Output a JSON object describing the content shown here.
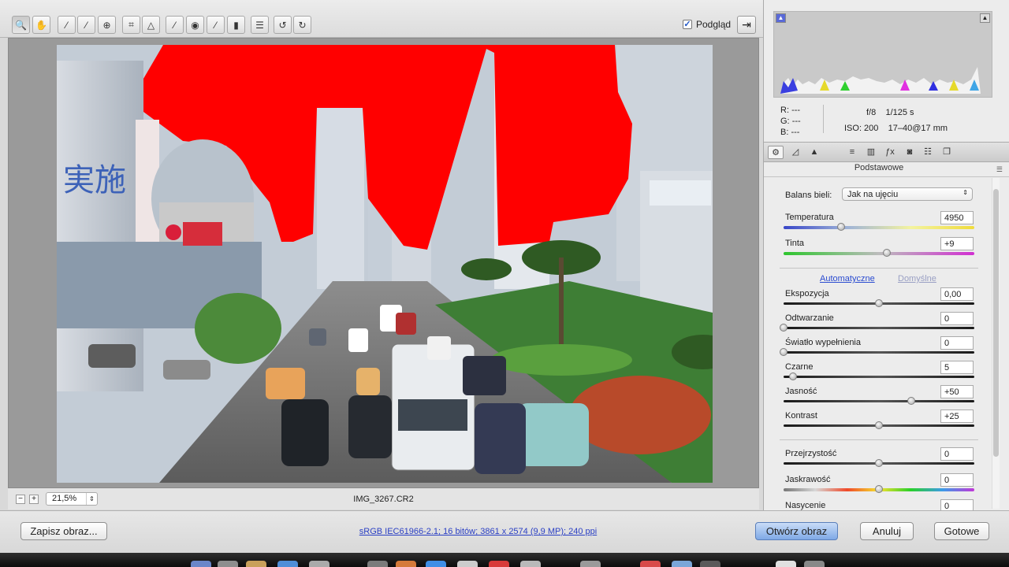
{
  "toolbar": {
    "tools": [
      {
        "name": "zoom-tool",
        "icon": "magnifier-icon",
        "glyph": "🔍"
      },
      {
        "name": "hand-tool",
        "icon": "hand-icon",
        "glyph": "✋"
      },
      {
        "name": "white-balance-tool",
        "icon": "eyedropper-icon",
        "glyph": "⁄"
      },
      {
        "name": "color-sampler-tool",
        "icon": "color-sampler-icon",
        "glyph": "⁄"
      },
      {
        "name": "targeted-adjustment-tool",
        "icon": "target-icon",
        "glyph": "⊕"
      },
      {
        "name": "crop-tool",
        "icon": "crop-icon",
        "glyph": "⌗"
      },
      {
        "name": "straighten-tool",
        "icon": "straighten-icon",
        "glyph": "△"
      },
      {
        "name": "spot-removal-tool",
        "icon": "spot-removal-icon",
        "glyph": "⁄"
      },
      {
        "name": "red-eye-tool",
        "icon": "red-eye-icon",
        "glyph": "◉"
      },
      {
        "name": "adjustment-brush-tool",
        "icon": "brush-icon",
        "glyph": "⁄"
      },
      {
        "name": "graduated-filter-tool",
        "icon": "gradient-icon",
        "glyph": "▮"
      },
      {
        "name": "preferences-tool",
        "icon": "list-icon",
        "glyph": "☰"
      },
      {
        "name": "rotate-ccw-tool",
        "icon": "rotate-left-icon",
        "glyph": "↺"
      },
      {
        "name": "rotate-cw-tool",
        "icon": "rotate-right-icon",
        "glyph": "↻"
      }
    ],
    "preview_label": "Podgląd",
    "preview_checked": true,
    "fullscreen_glyph": "⇥"
  },
  "canvas": {
    "zoom_minus": "−",
    "zoom_plus": "+",
    "zoom_value": "21,5%",
    "filename": "IMG_3267.CR2"
  },
  "info": {
    "r_label": "R:",
    "g_label": "G:",
    "b_label": "B:",
    "r_value": "---",
    "g_value": "---",
    "b_value": "---",
    "aperture": "f/8",
    "shutter": "1/125 s",
    "iso": "ISO: 200",
    "lens": "17–40@17 mm"
  },
  "panel": {
    "section_title": "Podstawowe",
    "white_balance_label": "Balans bieli:",
    "white_balance_value": "Jak na ujęciu",
    "auto_link": "Automatyczne",
    "default_link": "Domyślne",
    "sliders": [
      {
        "label": "Temperatura",
        "value": "4950",
        "position": 0.3
      },
      {
        "label": "Tinta",
        "value": "+9",
        "position": 0.54
      },
      {
        "label": "Ekspozycja",
        "value": "0,00",
        "position": 0.5
      },
      {
        "label": "Odtwarzanie",
        "value": "0",
        "position": 0.0
      },
      {
        "label": "Światło wypełnienia",
        "value": "0",
        "position": 0.0
      },
      {
        "label": "Czarne",
        "value": "5",
        "position": 0.05
      },
      {
        "label": "Jasność",
        "value": "+50",
        "position": 0.67
      },
      {
        "label": "Kontrast",
        "value": "+25",
        "position": 0.5
      },
      {
        "label": "Przejrzystość",
        "value": "0",
        "position": 0.5
      },
      {
        "label": "Jaskrawość",
        "value": "0",
        "position": 0.5
      },
      {
        "label": "Nasycenie",
        "value": "0",
        "position": 0.5
      }
    ]
  },
  "footer": {
    "save_label": "Zapisz obraz...",
    "workflow_link": "sRGB IEC61966-2.1; 16 bitów; 3861 x 2574 (9,9 MP); 240 ppi",
    "open_label": "Otwórz obraz",
    "cancel_label": "Anuluj",
    "done_label": "Gotowe"
  },
  "colors": {
    "clipping_overlay": "#ff0000",
    "link": "#2a4bd0",
    "primary_button": "#7fa9e6"
  }
}
